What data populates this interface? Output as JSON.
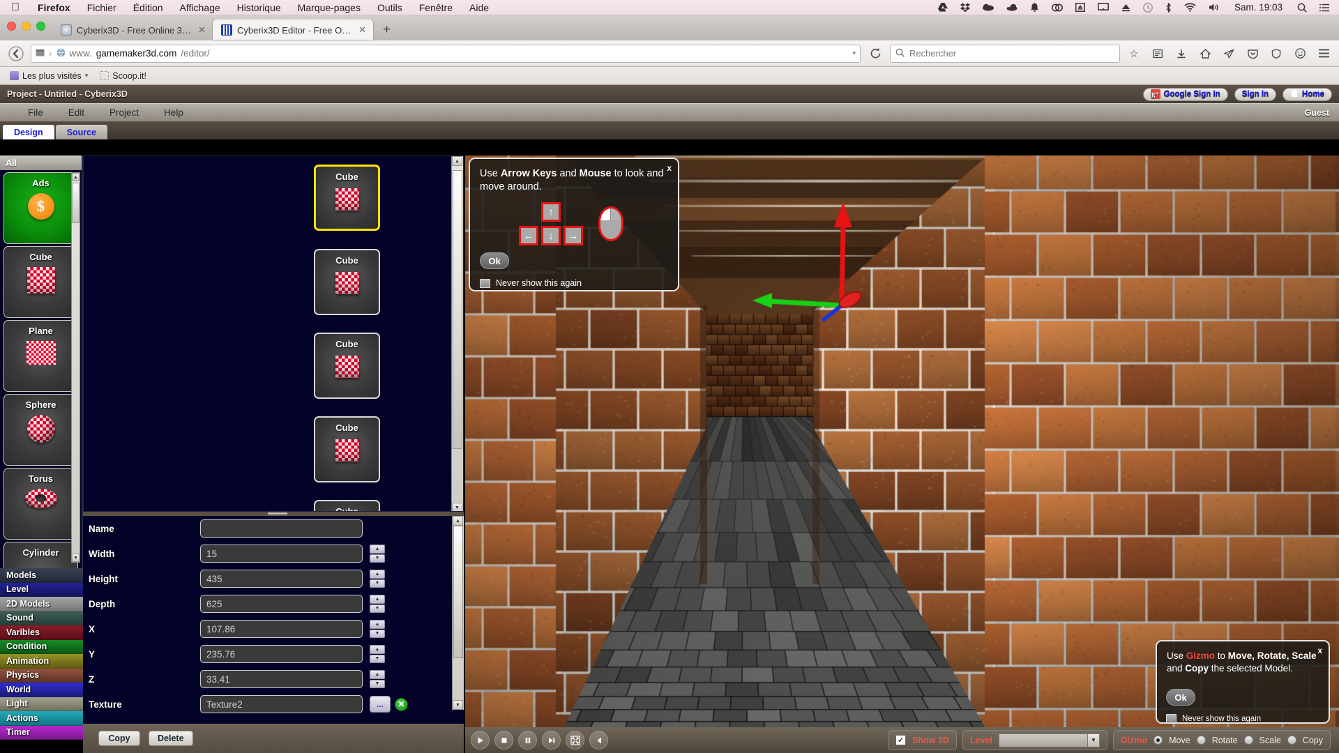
{
  "macbar": {
    "apple_icon": "apple-icon",
    "menus": [
      "Firefox",
      "Fichier",
      "Édition",
      "Affichage",
      "Historique",
      "Marque-pages",
      "Outils",
      "Fenêtre",
      "Aide"
    ],
    "status_icons": [
      "google-drive-icon",
      "dropbox-icon",
      "cloud-dark-icon",
      "cloud-icon",
      "bell-icon",
      "creative-cloud-icon",
      "upload-icon",
      "airplay-icon",
      "eject-icon",
      "time-machine-icon",
      "bluetooth-icon",
      "wifi-icon",
      "volume-icon"
    ],
    "clock": "Sam. 19:03",
    "search_icon": "search-icon",
    "list_icon": "notification-center-icon"
  },
  "browser": {
    "tabs": [
      {
        "title": "Cyberix3D - Free Online 3D ...",
        "active": false,
        "close": "✕"
      },
      {
        "title": "Cyberix3D Editor - Free Onli...",
        "active": true,
        "close": "✕"
      }
    ],
    "new_tab_label": "+",
    "back_icon": "back-arrow-icon",
    "url_prefix": "www.",
    "url_domain": "gamemaker3d.com",
    "url_path": "/editor/",
    "url_full": "www.gamemaker3d.com/editor/",
    "reload_icon": "reload-icon",
    "search_placeholder": "Rechercher",
    "toolbar_icons": [
      "star-icon",
      "reader-icon",
      "download-icon",
      "home-icon",
      "send-icon",
      "pocket-icon",
      "shield-icon",
      "smiley-icon",
      "menu-icon"
    ],
    "bookmarks": [
      {
        "label": "Les plus visités",
        "icon": "folder-icon",
        "caret": "▾"
      },
      {
        "label": "Scoop.it!",
        "icon": "bookmark-icon"
      }
    ]
  },
  "app": {
    "project_title": "Project - Untitled - Cyberix3D",
    "auth": {
      "google_sign_in": "Google Sign In",
      "google_badge": "g+",
      "sign_in": "Sign In",
      "home": "Home",
      "home_icon": "home-icon"
    },
    "menu": [
      "File",
      "Edit",
      "Project",
      "Help"
    ],
    "user": "Guest",
    "view_tabs": [
      {
        "label": "Design",
        "active": true
      },
      {
        "label": "Source",
        "active": false
      }
    ]
  },
  "palette": {
    "header": "All",
    "items": [
      {
        "label": "Ads",
        "shape": "coin"
      },
      {
        "label": "Cube",
        "shape": "cube"
      },
      {
        "label": "Plane",
        "shape": "plane"
      },
      {
        "label": "Sphere",
        "shape": "sphere"
      },
      {
        "label": "Torus",
        "shape": "torus"
      },
      {
        "label": "Cylinder",
        "shape": "cylinder"
      }
    ],
    "scroll_up": "▲",
    "scroll_down": "▼"
  },
  "categories": [
    {
      "label": "Models",
      "color": "#2b3040"
    },
    {
      "label": "Level",
      "color": "#161a6e"
    },
    {
      "label": "2D Models",
      "color": "#8d8d8d"
    },
    {
      "label": "Sound",
      "color": "#2f4a44"
    },
    {
      "label": "Varibles",
      "color": "#6e1620"
    },
    {
      "label": "Condition",
      "color": "#12701f"
    },
    {
      "label": "Animation",
      "color": "#7e7a1d"
    },
    {
      "label": "Physics",
      "color": "#7c4436"
    },
    {
      "label": "World",
      "color": "#2424a8"
    },
    {
      "label": "Light",
      "color": "#8d8f7e"
    },
    {
      "label": "Actions",
      "color": "#1a8e99"
    },
    {
      "label": "Timer",
      "color": "#a020b8"
    }
  ],
  "models_list": {
    "items": [
      {
        "label": "Cube",
        "selected": true
      },
      {
        "label": "Cube",
        "selected": false
      },
      {
        "label": "Cube",
        "selected": false
      },
      {
        "label": "Cube",
        "selected": false
      },
      {
        "label": "Cube",
        "selected": false
      }
    ]
  },
  "properties": {
    "fields": [
      {
        "label": "Name",
        "value": "",
        "spinner": true
      },
      {
        "label": "Width",
        "value": "15",
        "spinner": true
      },
      {
        "label": "Height",
        "value": "435",
        "spinner": true
      },
      {
        "label": "Depth",
        "value": "625",
        "spinner": true
      },
      {
        "label": "X",
        "value": "107.86",
        "spinner": true
      },
      {
        "label": "Y",
        "value": "235.76",
        "spinner": true
      },
      {
        "label": "Z",
        "value": "33.41",
        "spinner": true
      },
      {
        "label": "Texture",
        "value": "Texture2",
        "spinner": false
      }
    ],
    "browse_label": "...",
    "clear_label": "✕",
    "spin_up": "▲",
    "spin_down": "▼",
    "copy_button": "Copy",
    "delete_button": "Delete"
  },
  "popup_move": {
    "text_parts": [
      "Use ",
      "Arrow Keys",
      " and ",
      "Mouse",
      " to look and move around."
    ],
    "close": "x",
    "ok": "Ok",
    "never": "Never show this again",
    "keys": {
      "up": "↑",
      "left": "←",
      "down": "↓",
      "right": "→"
    }
  },
  "popup_gizmo": {
    "text_parts": [
      "Use ",
      "Gizmo",
      " to ",
      "Move, Rotate, Scale",
      " and ",
      "Copy",
      " the selected Model."
    ],
    "close": "x",
    "ok": "Ok",
    "never": "Never show this again",
    "accent_color": "#e8473a"
  },
  "bottombar": {
    "transport": [
      {
        "name": "play-button",
        "glyph": "▶"
      },
      {
        "name": "stop-button",
        "glyph": "■"
      },
      {
        "name": "pause-button",
        "glyph": "❚❚"
      },
      {
        "name": "step-button",
        "glyph": "▶|"
      },
      {
        "name": "fullscreen-button",
        "glyph": "⤢"
      },
      {
        "name": "mute-button",
        "glyph": "◀"
      }
    ],
    "show_2d": {
      "label": "Show 2D",
      "checked": true,
      "check_glyph": "✓"
    },
    "level": {
      "label": "Level",
      "value": "",
      "caret": "▼"
    },
    "gizmo": {
      "label": "Gizmo",
      "options": [
        {
          "label": "Move",
          "selected": true
        },
        {
          "label": "Rotate",
          "selected": false
        },
        {
          "label": "Scale",
          "selected": false
        },
        {
          "label": "Copy",
          "selected": false
        }
      ]
    }
  },
  "colors": {
    "accent_red": "#e25c4a",
    "selection_yellow": "#ffe400",
    "panel_blue": "#03032a",
    "chrome_brown": "#5b5044",
    "link_blue": "#1d1dd4"
  }
}
